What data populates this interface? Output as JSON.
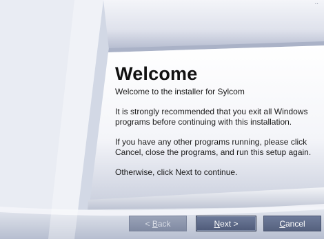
{
  "installer": {
    "title": "Welcome",
    "subtitle": "Welcome to the installer for Sylcom",
    "paragraphs": [
      "It is strongly recommended that you exit all Windows programs before continuing with this installation.",
      "If you have any other programs running, please click Cancel, close the programs, and run this setup again.",
      "Otherwise, click Next to continue."
    ]
  },
  "buttons": {
    "back": {
      "prefix": "< ",
      "mnemonic": "B",
      "rest": "ack",
      "enabled": false
    },
    "next": {
      "prefix": "",
      "mnemonic": "N",
      "rest": "ext >",
      "enabled": true
    },
    "cancel": {
      "prefix": "",
      "mnemonic": "C",
      "rest": "ancel",
      "enabled": true
    }
  },
  "colors": {
    "text": "#111111",
    "button_face": "#5f6b89",
    "button_disabled": "#8f98ae",
    "background_accent": "#a9b0c6"
  }
}
